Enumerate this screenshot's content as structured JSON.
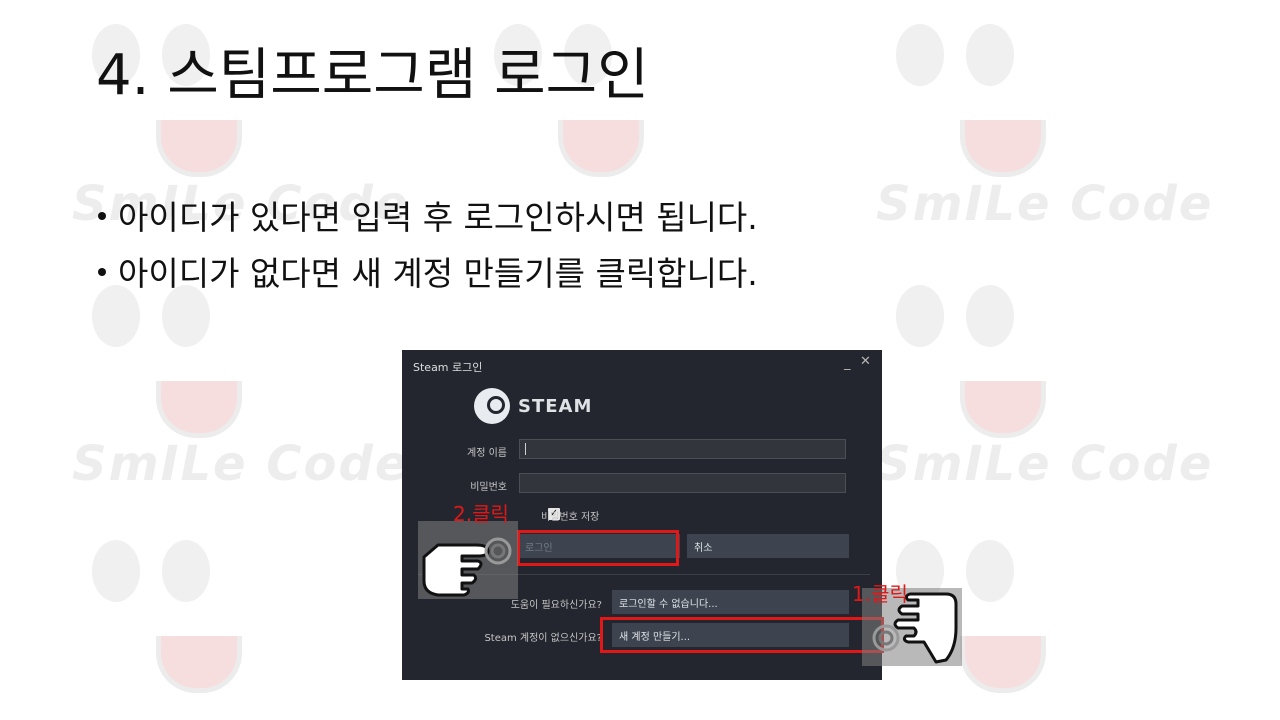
{
  "watermark": {
    "brand": "SmILe Code"
  },
  "slide": {
    "title": "4. 스팀프로그램 로그인",
    "bullets": [
      "아이디가 있다면 입력 후 로그인하시면 됩니다.",
      "아이디가 없다면 새 계정 만들기를 클릭합니다."
    ]
  },
  "steam_window": {
    "title": "Steam 로그인",
    "minimize": "_",
    "close": "✕",
    "logo_text": "STEAM",
    "account_label": "계정 이름",
    "account_value": "",
    "password_label": "비밀번호",
    "password_value": "",
    "remember_label": "비밀번호 저장",
    "remember_checked": true,
    "login_button": "로그인",
    "cancel_button": "취소",
    "help_question": "도움이 필요하신가요?",
    "help_button": "로그인할 수 없습니다...",
    "no_account_question": "Steam 계정이 없으신가요?",
    "create_account_button": "새 계정 만들기..."
  },
  "annotations": {
    "step1": "1.클릭",
    "step2": "2.클릭",
    "highlight_color": "#e01818"
  },
  "colors": {
    "window_bg": "#23262e",
    "button_bg": "#3d4450",
    "field_bg": "#32353c"
  }
}
